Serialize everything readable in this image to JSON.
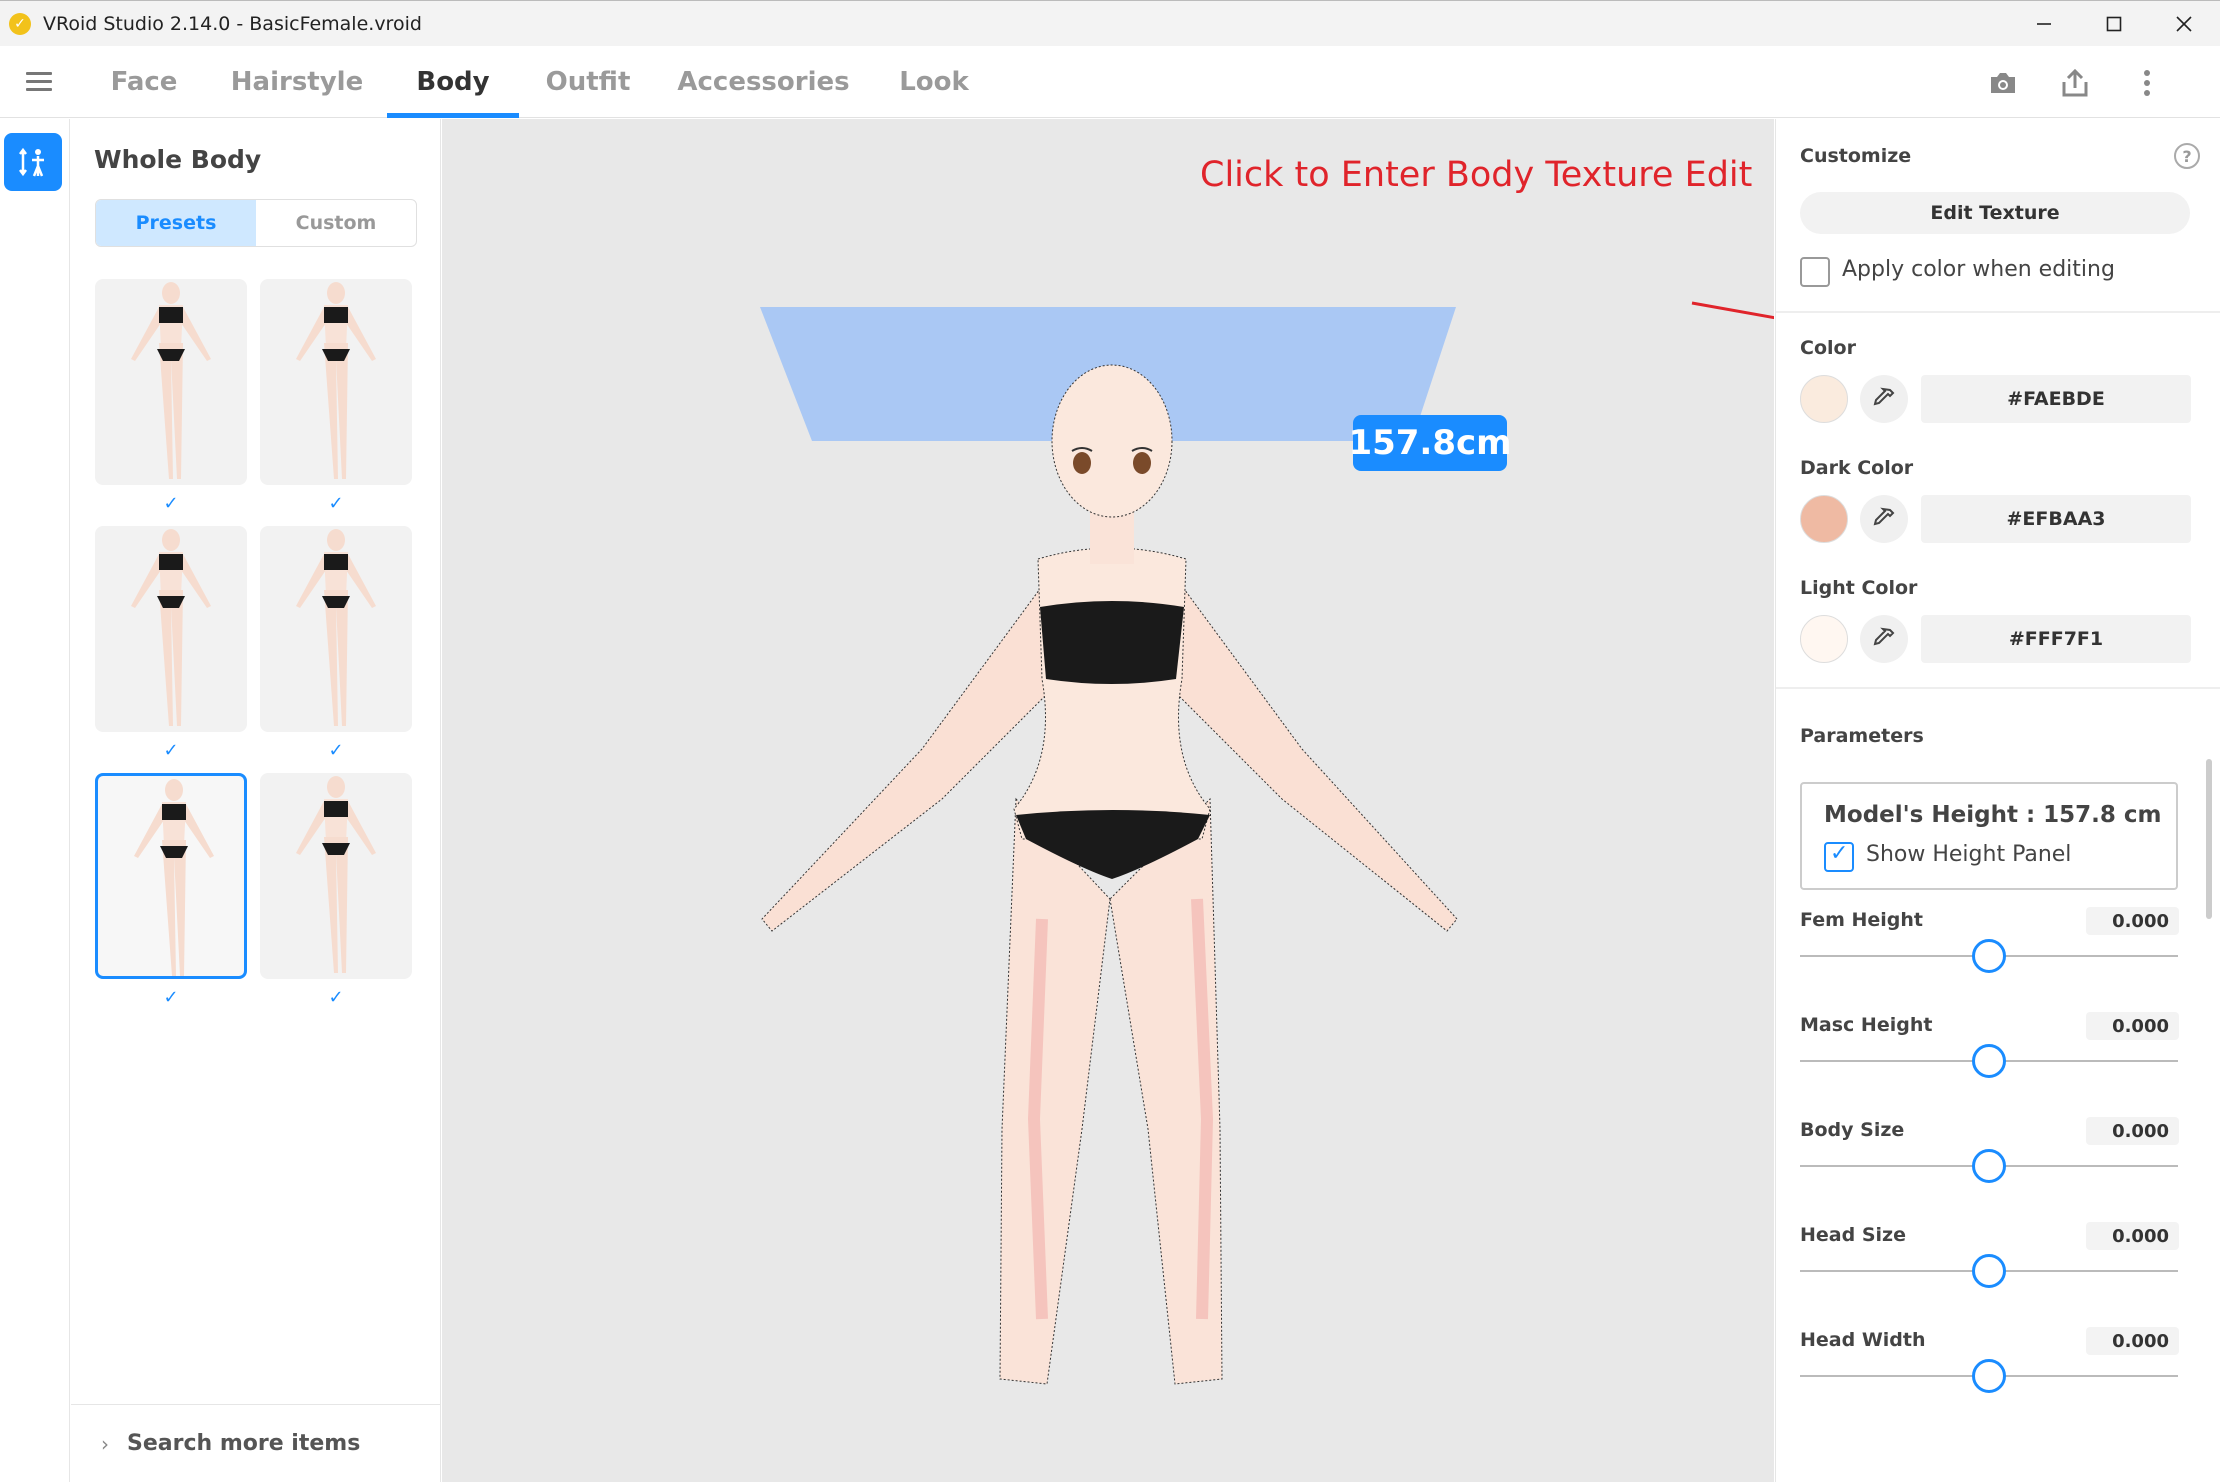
{
  "window": {
    "title": "VRoid Studio 2.14.0 - BasicFemale.vroid",
    "app_icon": "vroid-logo-icon",
    "controls": [
      "minimize-icon",
      "maximize-icon",
      "close-icon"
    ]
  },
  "menubar": {
    "tabs": [
      {
        "label": "Face",
        "active": false
      },
      {
        "label": "Hairstyle",
        "active": false
      },
      {
        "label": "Body",
        "active": true
      },
      {
        "label": "Outfit",
        "active": false
      },
      {
        "label": "Accessories",
        "active": false
      },
      {
        "label": "Look",
        "active": false
      }
    ],
    "icons": [
      "camera-icon",
      "export-icon",
      "more-vertical-icon"
    ]
  },
  "left_panel": {
    "title": "Whole Body",
    "segments": [
      {
        "label": "Presets",
        "active": true
      },
      {
        "label": "Custom",
        "active": false
      }
    ],
    "presets": [
      {
        "variant": "a",
        "checked": true,
        "selected": false
      },
      {
        "variant": "b",
        "checked": true,
        "selected": false
      },
      {
        "variant": "c",
        "checked": true,
        "selected": false
      },
      {
        "variant": "d",
        "checked": true,
        "selected": false
      },
      {
        "variant": "e",
        "checked": true,
        "selected": true
      },
      {
        "variant": "f",
        "checked": true,
        "selected": false
      }
    ],
    "search_more": "Search more items"
  },
  "viewport": {
    "height_badge": "157.8cm",
    "annotation": "Click to Enter Body Texture Edit"
  },
  "right_panel": {
    "customize_label": "Customize",
    "edit_texture": "Edit Texture",
    "apply_color_label": "Apply color when editing",
    "apply_color_checked": false,
    "colors": [
      {
        "label": "Color",
        "hex": "#FAEBDE"
      },
      {
        "label": "Dark Color",
        "hex": "#EFBAA3"
      },
      {
        "label": "Light Color",
        "hex": "#FFF7F1"
      }
    ],
    "parameters_label": "Parameters",
    "height_card": {
      "title": "Model's Height : 157.8 cm",
      "show_label": "Show Height Panel",
      "show_checked": true
    },
    "sliders": [
      {
        "label": "Fem Height",
        "value": "0.000",
        "position": 0.5
      },
      {
        "label": "Masc Height",
        "value": "0.000",
        "position": 0.5
      },
      {
        "label": "Body Size",
        "value": "0.000",
        "position": 0.5
      },
      {
        "label": "Head Size",
        "value": "0.000",
        "position": 0.5
      },
      {
        "label": "Head Width",
        "value": "0.000",
        "position": 0.5
      }
    ]
  },
  "colors": {
    "accent": "#1a8cff",
    "annotation": "#e0242b"
  }
}
